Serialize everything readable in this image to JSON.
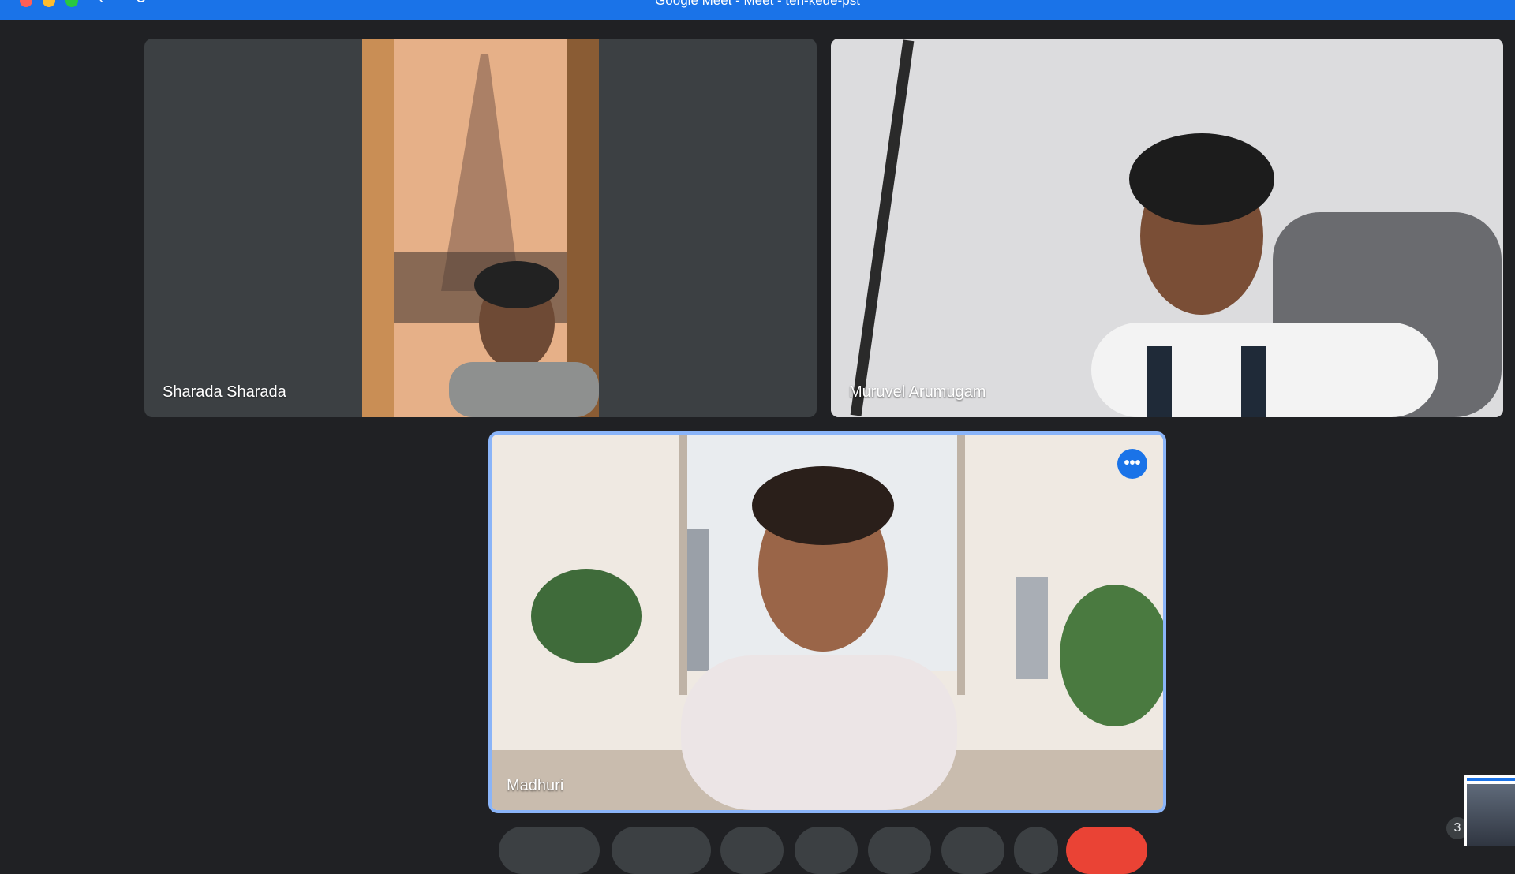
{
  "window": {
    "title": "Google Meet - Meet - ten-kede-pst"
  },
  "participants": [
    {
      "name": "Sharada Sharada"
    },
    {
      "name": "Muruvel Arumugam"
    },
    {
      "name": "Madhuri"
    }
  ],
  "icons": {
    "more_options": "•••",
    "back": "‹",
    "reload": "↻"
  },
  "participants_count": "3",
  "colors": {
    "accent": "#1a73e8",
    "background": "#202124",
    "tile": "#3c4043",
    "active_speaker_border": "#8ab4f8",
    "leave_button": "#ea4335"
  }
}
